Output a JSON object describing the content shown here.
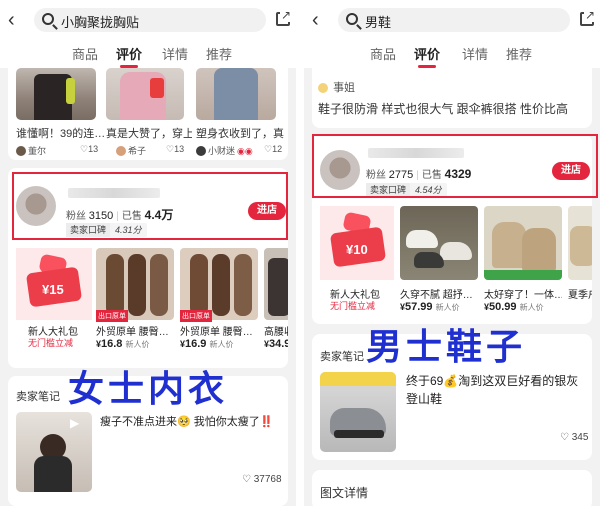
{
  "left": {
    "search_query": "小胸聚拢胸贴",
    "tabs": [
      "商品",
      "评价",
      "详情",
      "推荐"
    ],
    "active_tab": 1,
    "reviews": [
      {
        "text": "谁懂啊！39的连…",
        "user": "董尔",
        "likes": "13"
      },
      {
        "text": "真是大赞了，穿上…",
        "user": "希子",
        "likes": "13"
      },
      {
        "text": "塑身衣收到了，真…",
        "user": "小财迷",
        "likes": "12"
      }
    ],
    "shop": {
      "fans_label": "粉丝",
      "fans": "3150",
      "sold_label": "已售",
      "sold": "4.4万",
      "rating_label": "卖家口碑",
      "rating": "4.31分",
      "enter_label": "进店"
    },
    "products": [
      {
        "title": "新人大礼包",
        "sub": "无门槛立减",
        "gift_amount": "¥15",
        "price": ""
      },
      {
        "title": "外贸原单 腰臀…",
        "tag": "出口原单",
        "price": "16.8",
        "price_unit": "新人价"
      },
      {
        "title": "外贸原单 腰臀…",
        "tag": "出口原单",
        "price": "16.9",
        "price_unit": "新人价"
      },
      {
        "title": "高腰收腹…",
        "tag": "",
        "price": "34.9",
        "price_unit": ""
      }
    ],
    "notes_title": "卖家笔记",
    "note": {
      "text": "瘦子不准点进来🥺 我怕你太瘦了‼️",
      "likes": "37768"
    },
    "overlay_label": "女士内衣"
  },
  "right": {
    "search_query": "男鞋",
    "tabs": [
      "商品",
      "评价",
      "详情",
      "推荐"
    ],
    "active_tab": 1,
    "review_user": "事姐",
    "review_text": "鞋子很防滑 样式也很大气 跟伞裤很搭 性价比高",
    "shop": {
      "fans_label": "粉丝",
      "fans": "2775",
      "sold_label": "已售",
      "sold": "4329",
      "rating_label": "卖家口碑",
      "rating": "4.54分",
      "enter_label": "进店"
    },
    "products": [
      {
        "title": "新人大礼包",
        "sub": "无门槛立减",
        "gift_amount": "¥10"
      },
      {
        "title": "久穿不腻 超抒…",
        "price": "57.99",
        "price_unit": "新人价"
      },
      {
        "title": "太好穿了！一体…",
        "price": "50.99",
        "price_unit": "新人价"
      },
      {
        "title": "夏季户外",
        "price": "…",
        "price_unit": ""
      }
    ],
    "notes_title": "卖家笔记",
    "note": {
      "text": "终于69💰淘到这双巨好看的银灰登山鞋",
      "likes": "345"
    },
    "detail_title": "图文详情",
    "overlay_label": "男士鞋子"
  },
  "colors": {
    "accent": "#e3263d",
    "overlay": "#1f2fd0"
  }
}
